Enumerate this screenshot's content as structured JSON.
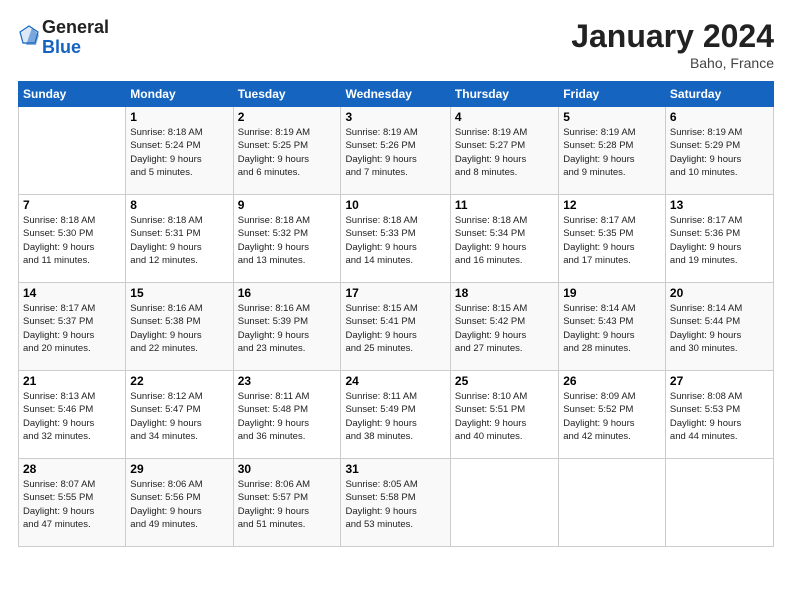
{
  "header": {
    "logo_line1": "General",
    "logo_line2": "Blue",
    "title": "January 2024",
    "subtitle": "Baho, France"
  },
  "columns": [
    "Sunday",
    "Monday",
    "Tuesday",
    "Wednesday",
    "Thursday",
    "Friday",
    "Saturday"
  ],
  "weeks": [
    [
      {
        "num": "",
        "info": ""
      },
      {
        "num": "1",
        "info": "Sunrise: 8:18 AM\nSunset: 5:24 PM\nDaylight: 9 hours\nand 5 minutes."
      },
      {
        "num": "2",
        "info": "Sunrise: 8:19 AM\nSunset: 5:25 PM\nDaylight: 9 hours\nand 6 minutes."
      },
      {
        "num": "3",
        "info": "Sunrise: 8:19 AM\nSunset: 5:26 PM\nDaylight: 9 hours\nand 7 minutes."
      },
      {
        "num": "4",
        "info": "Sunrise: 8:19 AM\nSunset: 5:27 PM\nDaylight: 9 hours\nand 8 minutes."
      },
      {
        "num": "5",
        "info": "Sunrise: 8:19 AM\nSunset: 5:28 PM\nDaylight: 9 hours\nand 9 minutes."
      },
      {
        "num": "6",
        "info": "Sunrise: 8:19 AM\nSunset: 5:29 PM\nDaylight: 9 hours\nand 10 minutes."
      }
    ],
    [
      {
        "num": "7",
        "info": "Sunrise: 8:18 AM\nSunset: 5:30 PM\nDaylight: 9 hours\nand 11 minutes."
      },
      {
        "num": "8",
        "info": "Sunrise: 8:18 AM\nSunset: 5:31 PM\nDaylight: 9 hours\nand 12 minutes."
      },
      {
        "num": "9",
        "info": "Sunrise: 8:18 AM\nSunset: 5:32 PM\nDaylight: 9 hours\nand 13 minutes."
      },
      {
        "num": "10",
        "info": "Sunrise: 8:18 AM\nSunset: 5:33 PM\nDaylight: 9 hours\nand 14 minutes."
      },
      {
        "num": "11",
        "info": "Sunrise: 8:18 AM\nSunset: 5:34 PM\nDaylight: 9 hours\nand 16 minutes."
      },
      {
        "num": "12",
        "info": "Sunrise: 8:17 AM\nSunset: 5:35 PM\nDaylight: 9 hours\nand 17 minutes."
      },
      {
        "num": "13",
        "info": "Sunrise: 8:17 AM\nSunset: 5:36 PM\nDaylight: 9 hours\nand 19 minutes."
      }
    ],
    [
      {
        "num": "14",
        "info": "Sunrise: 8:17 AM\nSunset: 5:37 PM\nDaylight: 9 hours\nand 20 minutes."
      },
      {
        "num": "15",
        "info": "Sunrise: 8:16 AM\nSunset: 5:38 PM\nDaylight: 9 hours\nand 22 minutes."
      },
      {
        "num": "16",
        "info": "Sunrise: 8:16 AM\nSunset: 5:39 PM\nDaylight: 9 hours\nand 23 minutes."
      },
      {
        "num": "17",
        "info": "Sunrise: 8:15 AM\nSunset: 5:41 PM\nDaylight: 9 hours\nand 25 minutes."
      },
      {
        "num": "18",
        "info": "Sunrise: 8:15 AM\nSunset: 5:42 PM\nDaylight: 9 hours\nand 27 minutes."
      },
      {
        "num": "19",
        "info": "Sunrise: 8:14 AM\nSunset: 5:43 PM\nDaylight: 9 hours\nand 28 minutes."
      },
      {
        "num": "20",
        "info": "Sunrise: 8:14 AM\nSunset: 5:44 PM\nDaylight: 9 hours\nand 30 minutes."
      }
    ],
    [
      {
        "num": "21",
        "info": "Sunrise: 8:13 AM\nSunset: 5:46 PM\nDaylight: 9 hours\nand 32 minutes."
      },
      {
        "num": "22",
        "info": "Sunrise: 8:12 AM\nSunset: 5:47 PM\nDaylight: 9 hours\nand 34 minutes."
      },
      {
        "num": "23",
        "info": "Sunrise: 8:11 AM\nSunset: 5:48 PM\nDaylight: 9 hours\nand 36 minutes."
      },
      {
        "num": "24",
        "info": "Sunrise: 8:11 AM\nSunset: 5:49 PM\nDaylight: 9 hours\nand 38 minutes."
      },
      {
        "num": "25",
        "info": "Sunrise: 8:10 AM\nSunset: 5:51 PM\nDaylight: 9 hours\nand 40 minutes."
      },
      {
        "num": "26",
        "info": "Sunrise: 8:09 AM\nSunset: 5:52 PM\nDaylight: 9 hours\nand 42 minutes."
      },
      {
        "num": "27",
        "info": "Sunrise: 8:08 AM\nSunset: 5:53 PM\nDaylight: 9 hours\nand 44 minutes."
      }
    ],
    [
      {
        "num": "28",
        "info": "Sunrise: 8:07 AM\nSunset: 5:55 PM\nDaylight: 9 hours\nand 47 minutes."
      },
      {
        "num": "29",
        "info": "Sunrise: 8:06 AM\nSunset: 5:56 PM\nDaylight: 9 hours\nand 49 minutes."
      },
      {
        "num": "30",
        "info": "Sunrise: 8:06 AM\nSunset: 5:57 PM\nDaylight: 9 hours\nand 51 minutes."
      },
      {
        "num": "31",
        "info": "Sunrise: 8:05 AM\nSunset: 5:58 PM\nDaylight: 9 hours\nand 53 minutes."
      },
      {
        "num": "",
        "info": ""
      },
      {
        "num": "",
        "info": ""
      },
      {
        "num": "",
        "info": ""
      }
    ]
  ]
}
